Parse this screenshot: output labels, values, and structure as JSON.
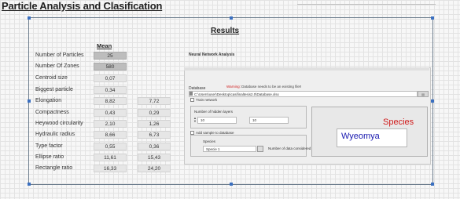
{
  "page_title": "Particle Analysis and Clasification",
  "results_title": "Results",
  "mean_header": "Mean",
  "rows": [
    {
      "label": "Number of Particles",
      "mean": "25",
      "col2": ""
    },
    {
      "label": "Number Of Zones",
      "mean": "580",
      "col2": ""
    },
    {
      "label": "Centroid size",
      "mean": "0,07",
      "col2": ""
    },
    {
      "label": "Biggest particle",
      "mean": "0,34",
      "col2": ""
    },
    {
      "label": "Elongation",
      "mean": "8,82",
      "col2": "7,72"
    },
    {
      "label": "Compactness",
      "mean": "0,43",
      "col2": "0,29"
    },
    {
      "label": "Heywood circularity",
      "mean": "2,10",
      "col2": "1,26"
    },
    {
      "label": "Hydraulic radius",
      "mean": "8,66",
      "col2": "6,73"
    },
    {
      "label": "Type factor",
      "mean": "0,55",
      "col2": "0,36"
    },
    {
      "label": "Ellipse ratio",
      "mean": "11,61",
      "col2": "15,43"
    },
    {
      "label": "Rectangle ratio",
      "mean": "16,33",
      "col2": "24,20"
    }
  ],
  "neural": {
    "section_label": "Neural Network Analysis",
    "database_label": "Database",
    "warning_prefix": "Warning:",
    "warning_text": "Database needs to be an existing file!!",
    "database_path": "C:\\Users\\user\\Desktop\\casifinaltesis2.0\\Database.xlsx",
    "train_network": "Train network",
    "hidden_layers_label": "Number of hidden layers",
    "hidden_layers_value": "10",
    "hidden_layers_value2": "10",
    "add_sample": "Add sample to database",
    "species_label": "Species",
    "species_selected": "Specie 1",
    "data_count_label": "Number of data considered",
    "species_title": "Species",
    "species_result": "Wyeomya"
  },
  "colors": {
    "species_title": "#d01a1a",
    "species_result": "#1a1ab0",
    "warning": "#d02020"
  }
}
